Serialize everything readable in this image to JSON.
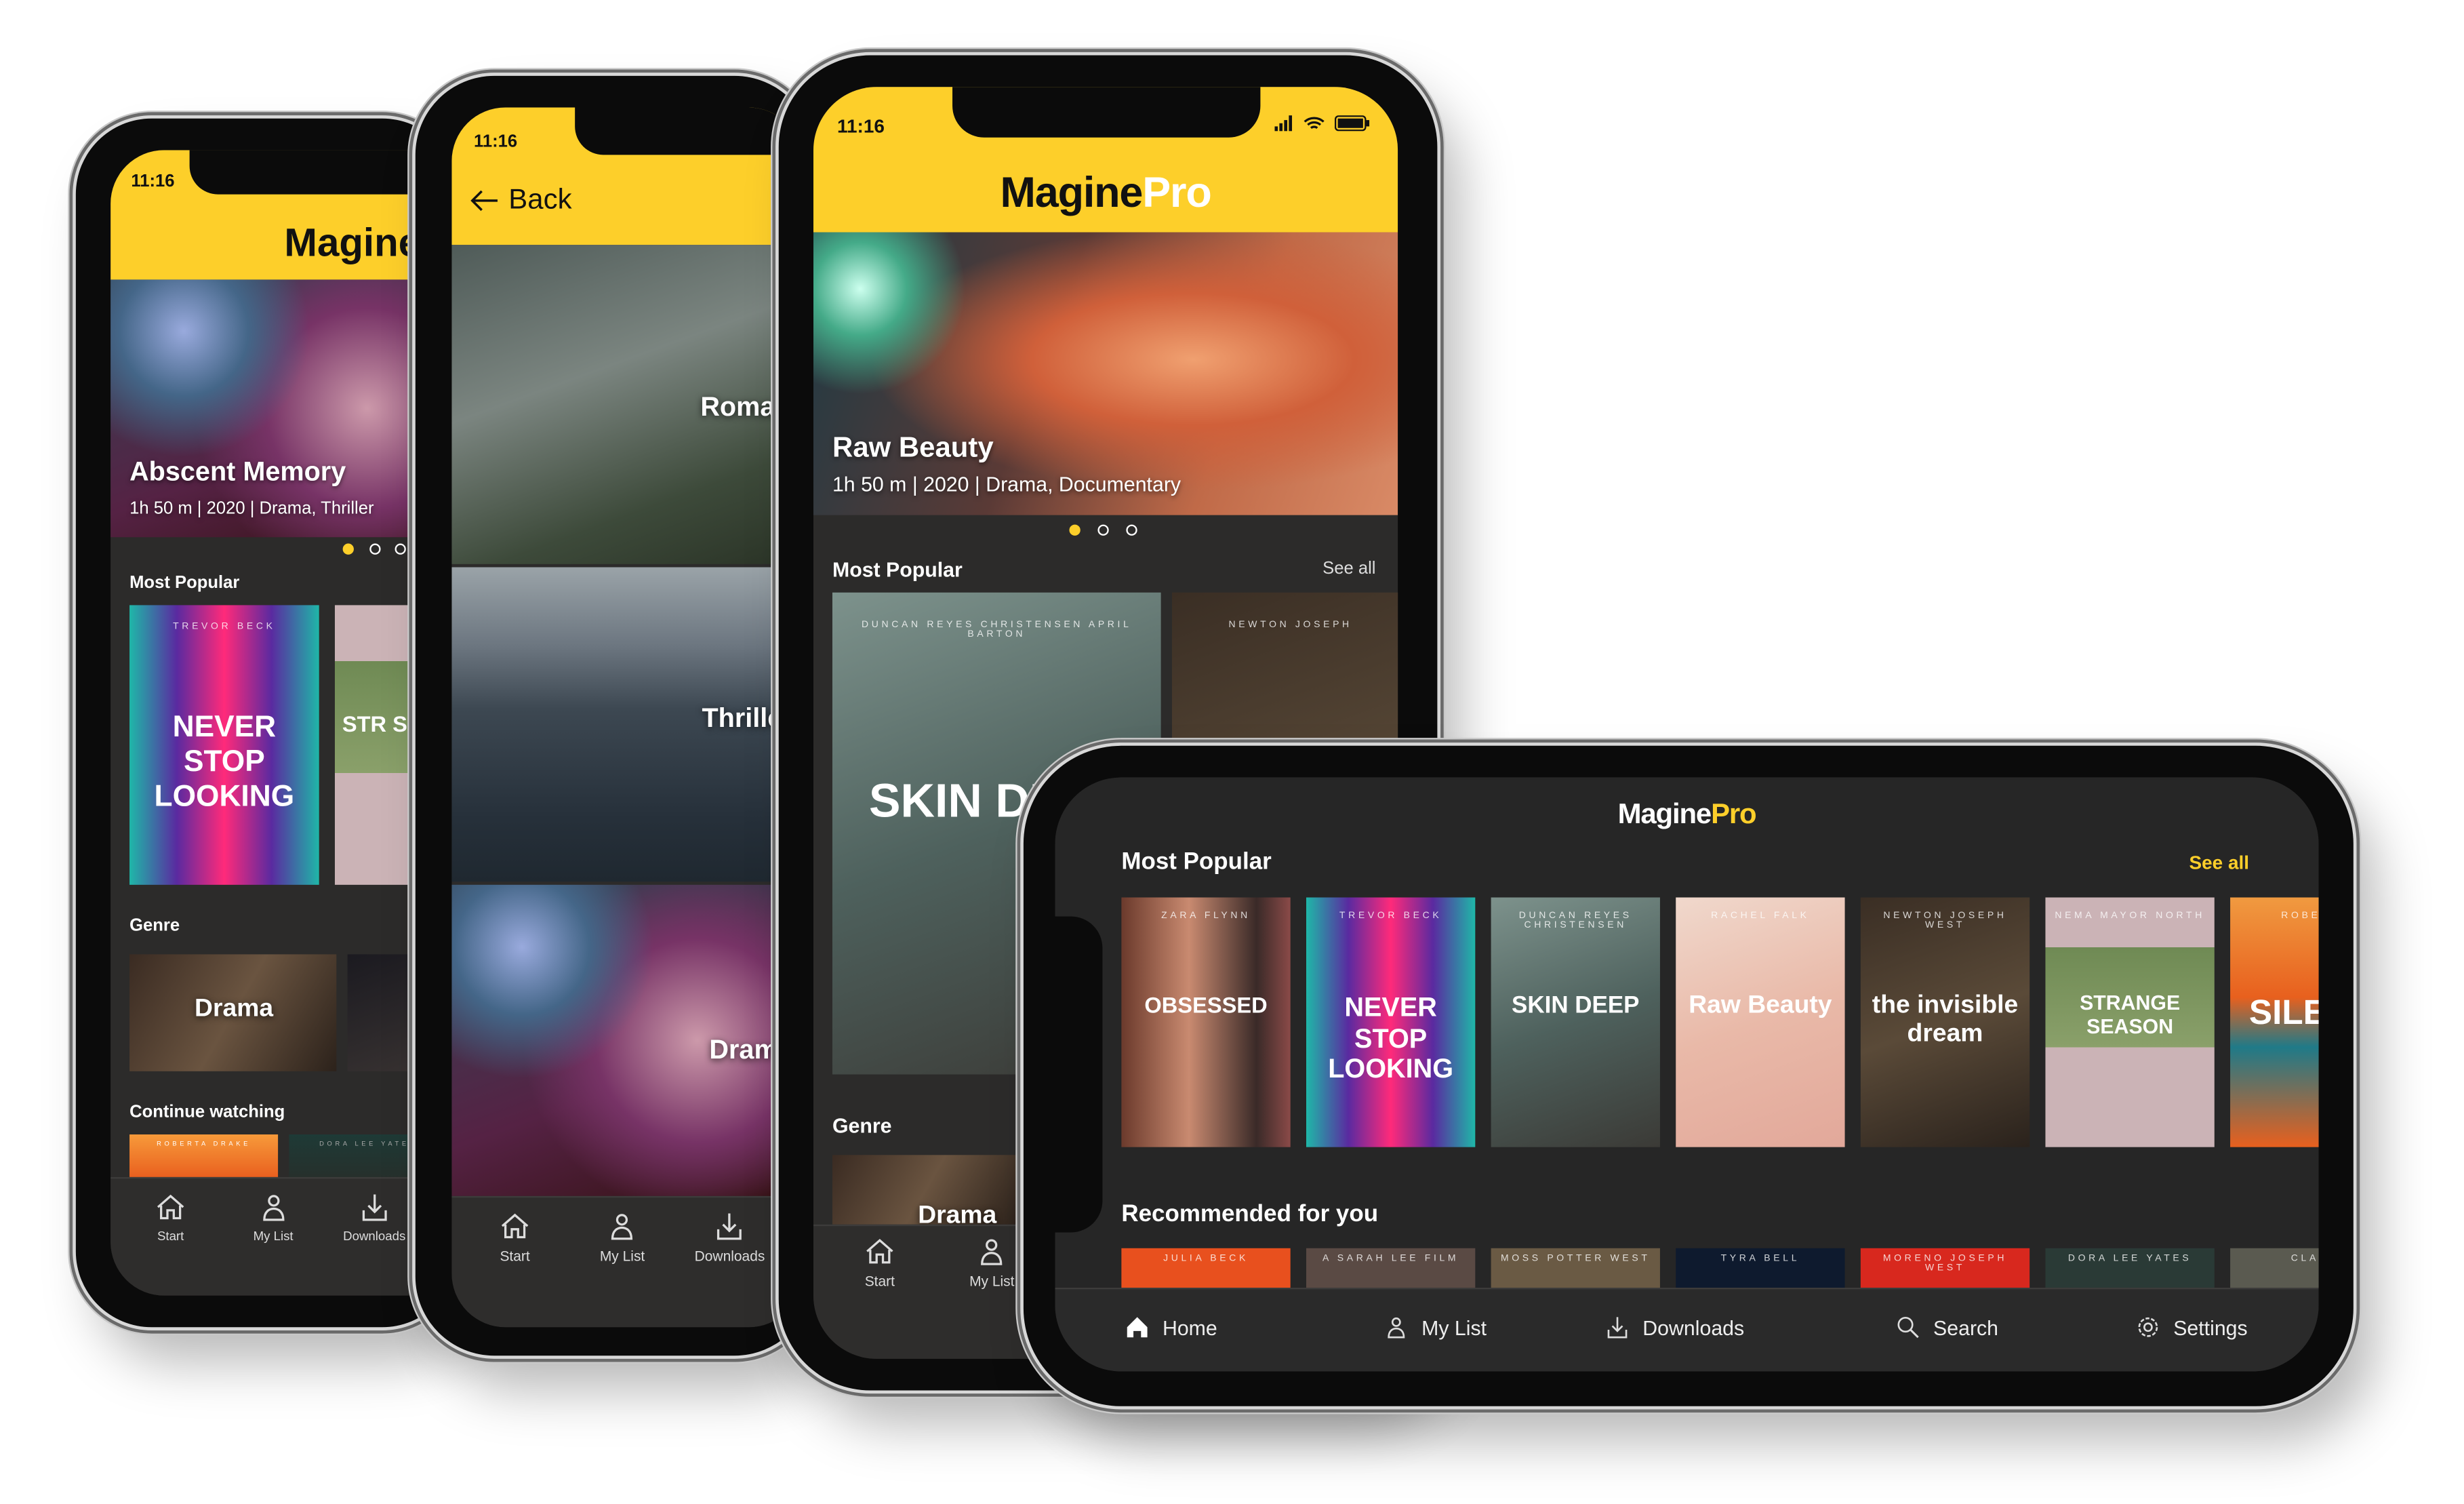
{
  "colors": {
    "accent": "#fdcf2a",
    "background": "#2c2b2a"
  },
  "logo": {
    "part1": "Magine",
    "part2": "Pro"
  },
  "phone_home": {
    "time": "11:16",
    "logo": "Magine",
    "hero": {
      "title": "Abscent Memory",
      "meta": "1h 50 m | 2020 | Drama, Thriller",
      "pages": 3,
      "active_page": 1
    },
    "most_popular": "Most Popular",
    "posters": [
      {
        "title": "NEVER STOP LOOKING",
        "credit": "TREVOR BECK"
      },
      {
        "title": "STR SEA",
        "credit": ""
      }
    ],
    "genre": "Genre",
    "genres": [
      "Drama",
      ""
    ],
    "continue_watching": "Continue watching",
    "continue": [
      "ROBERTA DRAKE",
      "DORA LEE YATES"
    ],
    "nav": [
      {
        "label": "Start",
        "icon": "home-outline-icon"
      },
      {
        "label": "My List",
        "icon": "person-icon"
      },
      {
        "label": "Downloads",
        "icon": "download-icon"
      }
    ]
  },
  "phone_genres": {
    "time": "11:16",
    "back": "Back",
    "genres": [
      "Romance",
      "Thriller",
      "Drama"
    ],
    "nav": [
      {
        "label": "Start",
        "icon": "home-outline-icon"
      },
      {
        "label": "My List",
        "icon": "person-icon"
      },
      {
        "label": "Downloads",
        "icon": "download-icon"
      }
    ]
  },
  "phone_pro": {
    "time": "11:16",
    "hero": {
      "title": "Raw Beauty",
      "meta": "1h 50 m | 2020 | Drama, Documentary",
      "pages": 3,
      "active_page": 1
    },
    "most_popular": "Most Popular",
    "see_all": "See all",
    "posters": [
      {
        "title": "SKIN DEEP",
        "credit": "DUNCAN  REYES  CHRISTENSEN  APRIL BARTON"
      },
      {
        "title": "",
        "credit": "NEWTON  JOSEPH"
      }
    ],
    "genre": "Genre",
    "genres": [
      "Drama"
    ],
    "nav": [
      {
        "label": "Start",
        "icon": "home-outline-icon"
      },
      {
        "label": "My List",
        "icon": "person-icon"
      }
    ]
  },
  "tablet": {
    "most_popular": "Most Popular",
    "see_all": "See all",
    "posters": [
      {
        "title": "OBSESSED",
        "credit": "ZARA FLYNN"
      },
      {
        "title": "NEVER STOP LOOKING",
        "credit": "TREVOR BECK"
      },
      {
        "title": "SKIN DEEP",
        "credit": "DUNCAN  REYES  CHRISTENSEN"
      },
      {
        "title": "Raw Beauty",
        "credit": "RACHEL FALK"
      },
      {
        "title": "the invisible dream",
        "credit": "NEWTON  JOSEPH  WEST"
      },
      {
        "title": "STRANGE SEASON",
        "credit": "NEMA  MAYOR  NORTH"
      },
      {
        "title": "SILE TE",
        "credit": "ROBERTA"
      }
    ],
    "recommended": "Recommended for you",
    "recommended_items": [
      "JULIA BECK",
      "A SARAH LEE FILM",
      "MOSS  POTTER  WEST",
      "TYRA BELL",
      "MORENO  JOSEPH  WEST",
      "DORA LEE YATES",
      "CLARE"
    ],
    "nav": [
      {
        "label": "Home",
        "icon": "home-filled-icon"
      },
      {
        "label": "My List",
        "icon": "person-icon"
      },
      {
        "label": "Downloads",
        "icon": "download-icon"
      },
      {
        "label": "Search",
        "icon": "search-icon"
      },
      {
        "label": "Settings",
        "icon": "gear-icon"
      }
    ]
  }
}
